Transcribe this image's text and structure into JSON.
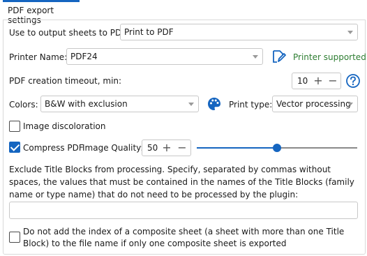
{
  "tab": {
    "label": "PDF export settings"
  },
  "output": {
    "label": "Use to output sheets to PDF:",
    "value": "Print to PDF"
  },
  "printer": {
    "label": "Printer Name:",
    "value": "PDF24",
    "status": "Printer supported"
  },
  "timeout": {
    "label": "PDF creation timeout, min:",
    "value": "10"
  },
  "colors": {
    "label": "Colors:",
    "value": "B&W with exclusion"
  },
  "print_type": {
    "label": "Print type:",
    "value": "Vector processing"
  },
  "image_discoloration": {
    "label": "Image discoloration",
    "checked": false
  },
  "compress": {
    "label": "Compress PDF",
    "checked": true,
    "quality_label": "Image Quality:",
    "quality_value": "50",
    "quality_fraction": 0.5
  },
  "exclude": {
    "description": "Exclude Title Blocks from processing. Specify, separated by commas without spaces, the values that must be contained in the names of the Title Blocks (family name or type name) that do not need to be processed by the plugin:",
    "value": ""
  },
  "composite": {
    "label": "Do not add the index of a composite sheet (a sheet with more than one Title Block) to the file name if only one composite sheet is exported",
    "checked": false
  },
  "colors_theme": {
    "accent": "#1565c0",
    "success": "#2e7d32",
    "border": "#c8c8c8"
  },
  "icons": {
    "edit": "edit-printer-icon",
    "help": "help-icon",
    "palette": "palette-icon"
  }
}
